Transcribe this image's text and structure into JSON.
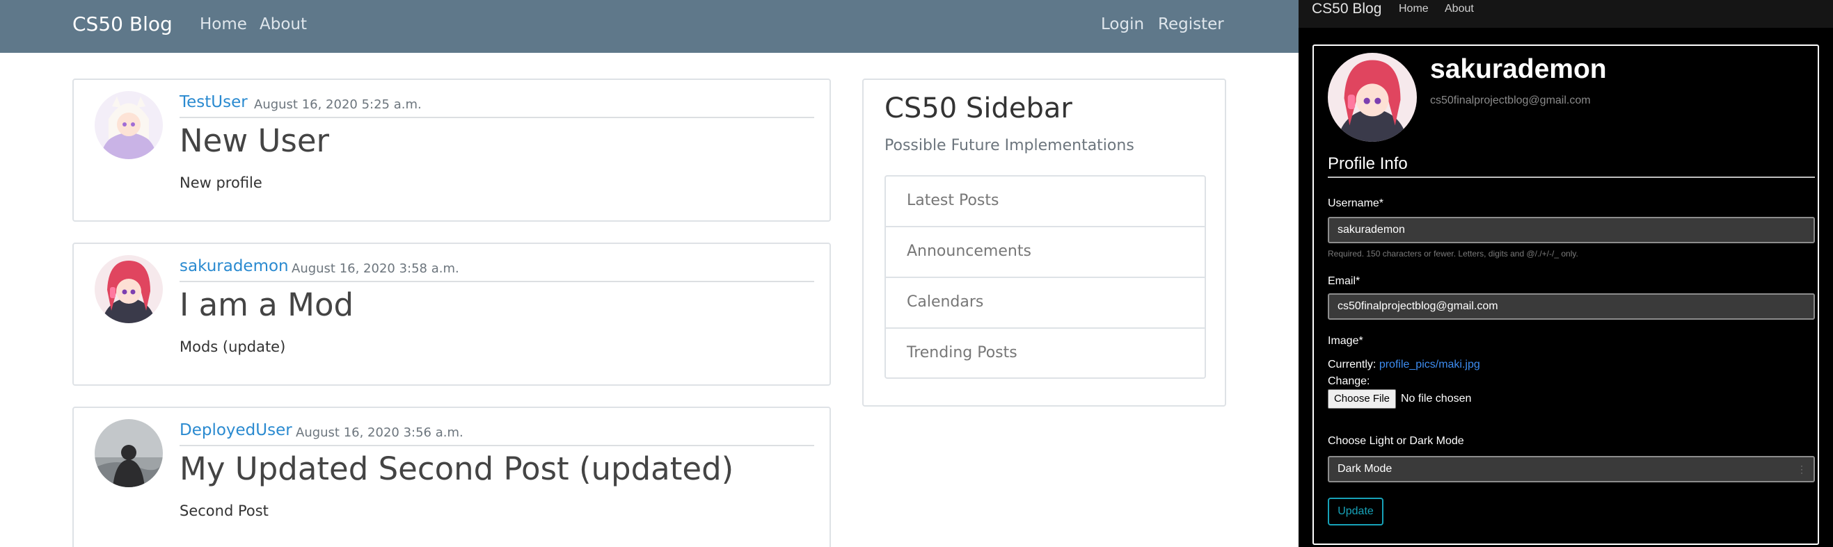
{
  "light_nav": {
    "brand": "CS50 Blog",
    "home": "Home",
    "about": "About",
    "login": "Login",
    "register": "Register",
    "bar_color": "#5f788a"
  },
  "posts": [
    {
      "author": "TestUser",
      "date": "August 16, 2020 5:25 a.m.",
      "title": "New User",
      "body": "New profile"
    },
    {
      "author": "sakurademon",
      "date": "August 16, 2020 3:58 a.m.",
      "title": "I am a Mod",
      "body": "Mods (update)"
    },
    {
      "author": "DeployedUser",
      "date": "August 16, 2020 3:56 a.m.",
      "title": "My Updated Second Post (updated)",
      "body": "Second Post"
    }
  ],
  "sidebar": {
    "title": "CS50 Sidebar",
    "subtitle": "Possible Future Implementations",
    "items": [
      "Latest Posts",
      "Announcements",
      "Calendars",
      "Trending Posts"
    ]
  },
  "dark_nav": {
    "brand": "CS50 Blog",
    "home": "Home",
    "about": "About"
  },
  "profile": {
    "username": "sakurademon",
    "email": "cs50finalprojectblog@gmail.com",
    "section_title": "Profile Info",
    "username_label": "Username*",
    "username_value": "sakurademon",
    "username_help": "Required. 150 characters or fewer. Letters, digits and @/./+/-/_ only.",
    "email_label": "Email*",
    "email_value": "cs50finalprojectblog@gmail.com",
    "image_label": "Image*",
    "currently_label": "Currently:",
    "currently_link": "profile_pics/maki.jpg",
    "change_label": "Change:",
    "choose_file": "Choose File",
    "no_file": "No file chosen",
    "mode_label": "Choose Light or Dark Mode",
    "mode_value": "Dark Mode",
    "update_button": "Update"
  }
}
